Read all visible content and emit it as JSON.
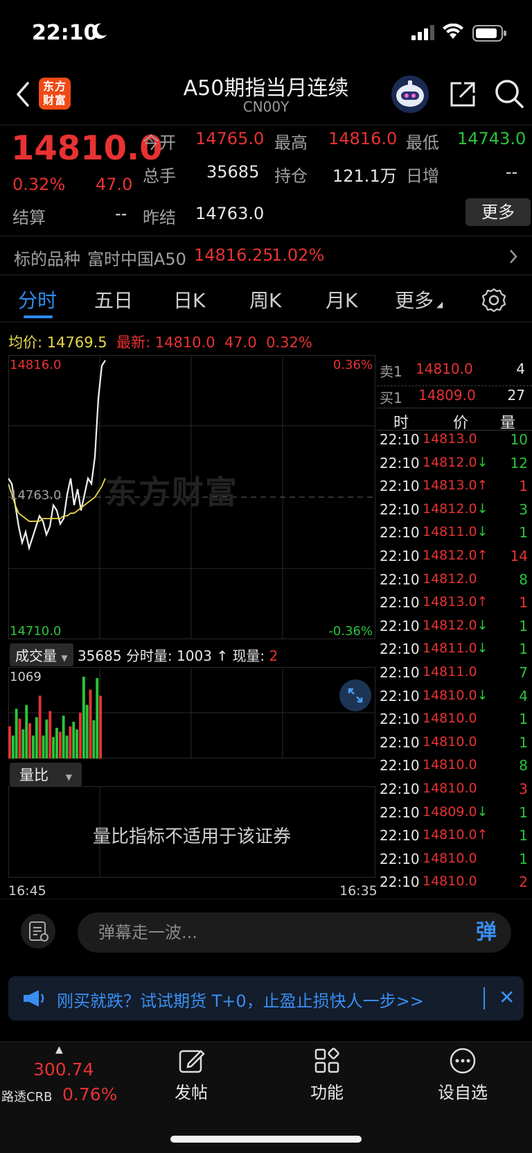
{
  "status": {
    "time": "22:10"
  },
  "header": {
    "logo_line1": "东方",
    "logo_line2": "财富",
    "title": "A50期指当月连续",
    "subtitle": "CN00Y"
  },
  "quote": {
    "price": "14810.0",
    "change_pct": "0.32%",
    "change": "47.0",
    "open_label": "今开",
    "open": "14765.0",
    "high_label": "最高",
    "high": "14816.0",
    "low_label": "最低",
    "low": "14743.0",
    "volume_label": "总手",
    "volume": "35685",
    "oi_label": "持仓",
    "oi": "121.1万",
    "daily_inc_label": "日增",
    "daily_inc": "--",
    "settle_label": "结算",
    "settle": "--",
    "prev_settle_label": "昨结",
    "prev_settle": "14763.0",
    "more_label": "更多"
  },
  "underlying": {
    "label": "标的品种",
    "name": "富时中国A50",
    "price": "14816.25",
    "pct": "1.02%"
  },
  "tabs": [
    "分时",
    "五日",
    "日K",
    "周K",
    "月K",
    "更多"
  ],
  "info": {
    "avg_label": "均价:",
    "avg": "14769.5",
    "latest_label": "最新:",
    "latest": "14810.0",
    "chg": "47.0",
    "pct": "0.32%"
  },
  "chart_data": {
    "type": "line",
    "title": "",
    "ylim": [
      14710.0,
      14816.0
    ],
    "y_top_label": "14816.0",
    "y_mid_label": "14763.0",
    "y_bottom_label": "14710.0",
    "pct_top": "0.36%",
    "pct_bottom": "-0.36%",
    "watermark": "东方财富",
    "series": [
      {
        "name": "",
        "values": [
          14770,
          14768,
          14760,
          14752,
          14746,
          14750,
          14744,
          14748,
          14752,
          14756,
          14754,
          14749,
          14752,
          14760,
          14758,
          14753,
          14755,
          14764,
          14770,
          14760,
          14766,
          14758,
          14764,
          14770,
          14768,
          14778,
          14800,
          14812,
          14814
        ]
      },
      {
        "name": "均价",
        "values": [
          14768,
          14764,
          14760,
          14757,
          14756,
          14755,
          14754,
          14754,
          14754,
          14754,
          14755,
          14755,
          14755,
          14755,
          14755,
          14755,
          14756,
          14756,
          14757,
          14757,
          14758,
          14759,
          14760,
          14761,
          14762,
          14763,
          14765,
          14767,
          14770
        ]
      }
    ],
    "volume": [
      420,
      300,
      650,
      520,
      380,
      700,
      460,
      300,
      540,
      820,
      300,
      510,
      620,
      280,
      400,
      350,
      560,
      300,
      420,
      480,
      380,
      600,
      1069,
      700,
      900,
      500,
      1050,
      820
    ]
  },
  "volume": {
    "label": "成交量",
    "total": "35685",
    "tick_label": "分时量:",
    "tick": "1003",
    "now_label": "现量:",
    "now": "2",
    "max": "1069"
  },
  "ratio": {
    "label": "量比",
    "message": "量比指标不适用于该证券"
  },
  "time_axis": {
    "start": "16:45",
    "end": "16:35"
  },
  "book": {
    "ask_label": "卖1",
    "ask_price": "14810.0",
    "ask_vol": "4",
    "bid_label": "买1",
    "bid_price": "14809.0",
    "bid_vol": "27",
    "col_time": "时",
    "col_price": "价",
    "col_vol": "量"
  },
  "trades": [
    {
      "time": "22:10",
      "price": "14813.0",
      "arrow": "",
      "vol": "10",
      "color": "#2bc43c"
    },
    {
      "time": "22:10",
      "price": "14812.0",
      "arrow": "↓",
      "vol": "12",
      "color": "#2bc43c"
    },
    {
      "time": "22:10",
      "price": "14813.0",
      "arrow": "↑",
      "vol": "1",
      "color": "#e83232"
    },
    {
      "time": "22:10",
      "price": "14812.0",
      "arrow": "↓",
      "vol": "3",
      "color": "#2bc43c"
    },
    {
      "time": "22:10",
      "price": "14811.0",
      "arrow": "↓",
      "vol": "1",
      "color": "#2bc43c"
    },
    {
      "time": "22:10",
      "price": "14812.0",
      "arrow": "↑",
      "vol": "14",
      "color": "#e83232"
    },
    {
      "time": "22:10",
      "price": "14812.0",
      "arrow": "",
      "vol": "8",
      "color": "#2bc43c"
    },
    {
      "time": "22:10",
      "price": "14813.0",
      "arrow": "↑",
      "vol": "1",
      "color": "#e83232"
    },
    {
      "time": "22:10",
      "price": "14812.0",
      "arrow": "↓",
      "vol": "1",
      "color": "#2bc43c"
    },
    {
      "time": "22:10",
      "price": "14811.0",
      "arrow": "↓",
      "vol": "1",
      "color": "#2bc43c"
    },
    {
      "time": "22:10",
      "price": "14811.0",
      "arrow": "",
      "vol": "7",
      "color": "#2bc43c"
    },
    {
      "time": "22:10",
      "price": "14810.0",
      "arrow": "↓",
      "vol": "4",
      "color": "#2bc43c"
    },
    {
      "time": "22:10",
      "price": "14810.0",
      "arrow": "",
      "vol": "1",
      "color": "#2bc43c"
    },
    {
      "time": "22:10",
      "price": "14810.0",
      "arrow": "",
      "vol": "1",
      "color": "#2bc43c"
    },
    {
      "time": "22:10",
      "price": "14810.0",
      "arrow": "",
      "vol": "8",
      "color": "#2bc43c"
    },
    {
      "time": "22:10",
      "price": "14810.0",
      "arrow": "",
      "vol": "3",
      "color": "#e83232"
    },
    {
      "time": "22:10",
      "price": "14809.0",
      "arrow": "↓",
      "vol": "1",
      "color": "#2bc43c"
    },
    {
      "time": "22:10",
      "price": "14810.0",
      "arrow": "↑",
      "vol": "1",
      "color": "#2bc43c"
    },
    {
      "time": "22:10",
      "price": "14810.0",
      "arrow": "",
      "vol": "1",
      "color": "#2bc43c"
    },
    {
      "time": "22:10",
      "price": "14810.0",
      "arrow": "",
      "vol": "2",
      "color": "#e83232"
    }
  ],
  "danmu": {
    "placeholder": "弹幕走一波...",
    "button": "弹"
  },
  "promo": {
    "text": "刚买就跌？试试期货 T+0，止盈止损快人一步>>"
  },
  "bottom": {
    "index_value": "300.74",
    "index_name": "路透CRB",
    "index_pct": "0.76%",
    "post": "发帖",
    "func": "功能",
    "watchlist": "设自选"
  }
}
